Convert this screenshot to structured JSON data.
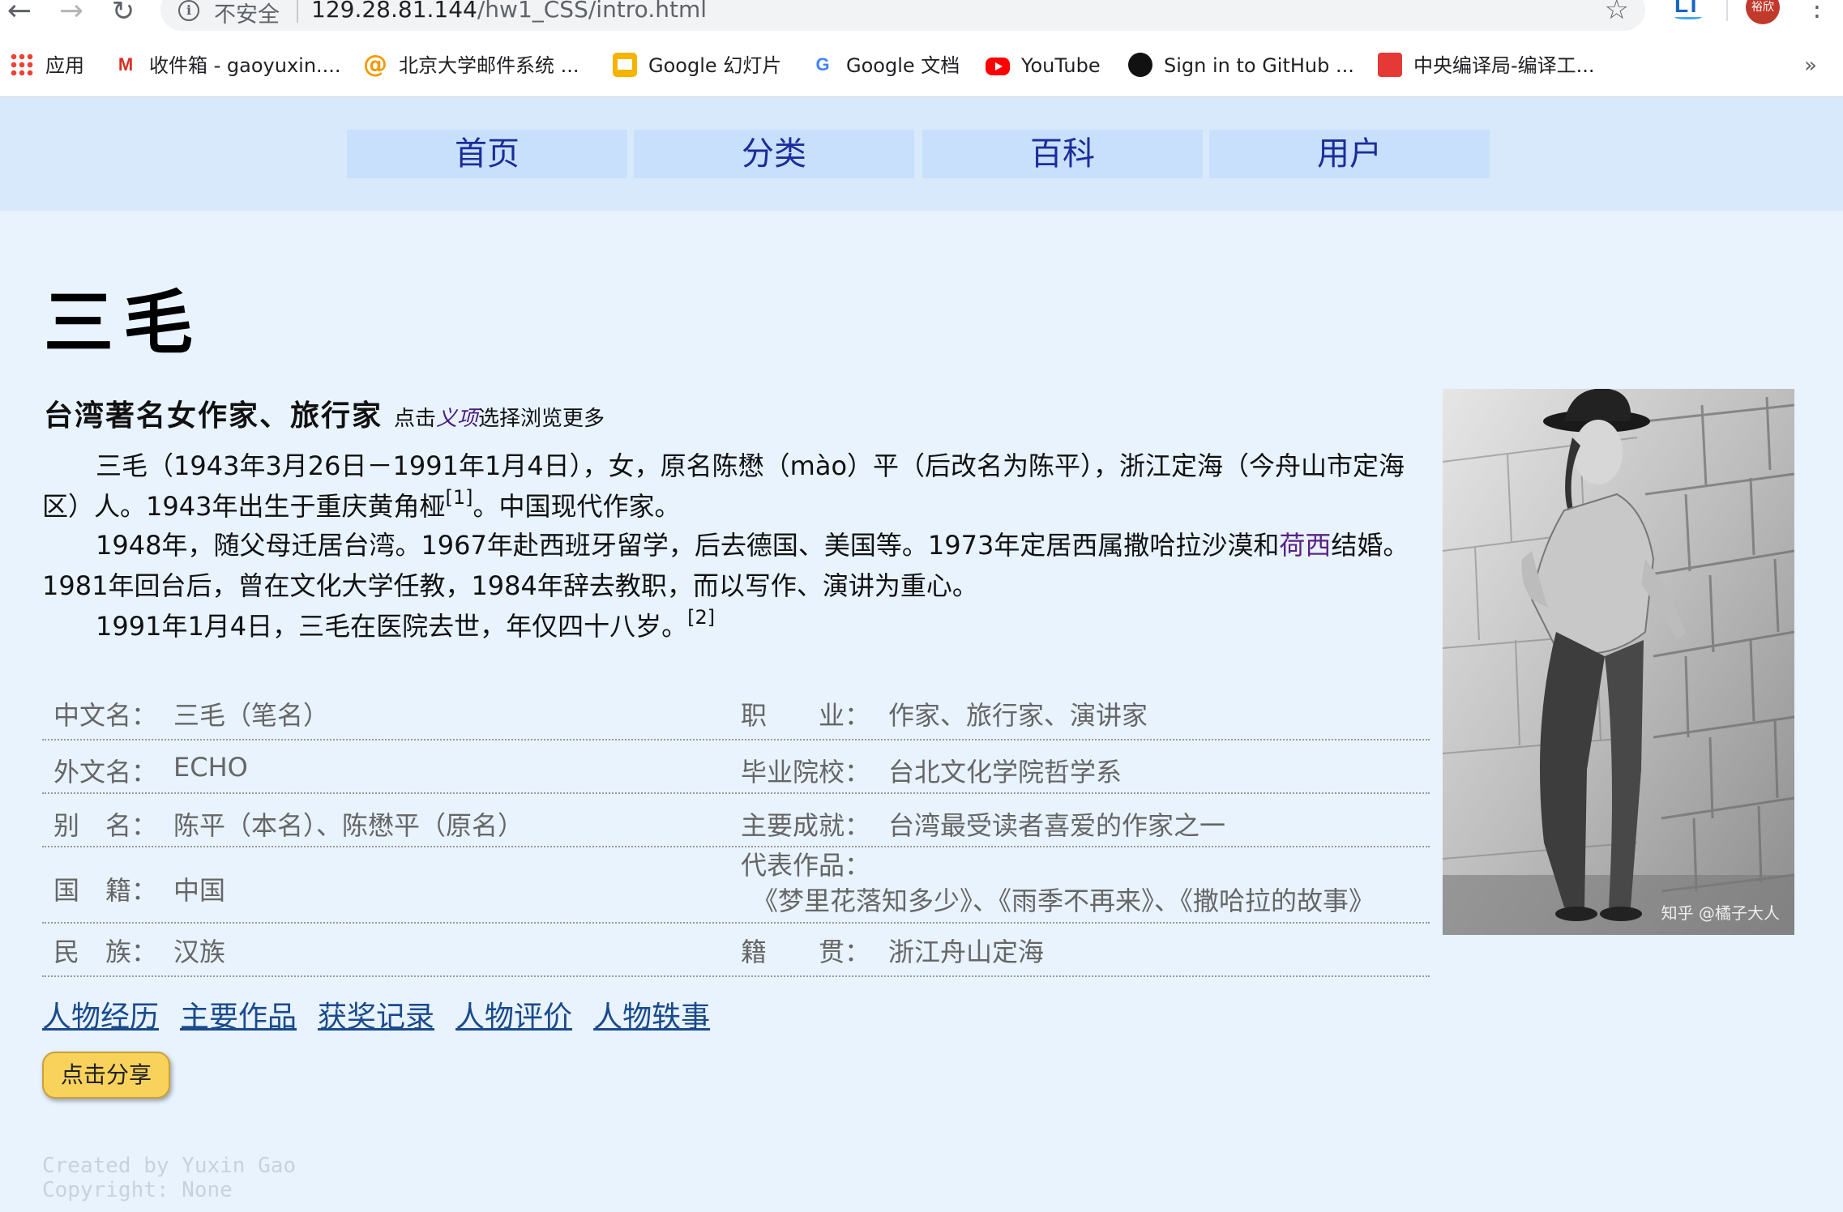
{
  "browser": {
    "security_label": "不安全",
    "url_host": "129.28.81.144",
    "url_path": "/hw1_CSS/intro.html",
    "extension_label": "LT",
    "avatar_text": "裕欣",
    "bookmarks": [
      {
        "label": "应用",
        "icon": "apps-grid-icon"
      },
      {
        "label": "收件箱 - gaoyuxin....",
        "icon": "gmail-icon"
      },
      {
        "label": "北京大学邮件系统 ...",
        "icon": "at-sign-icon"
      },
      {
        "label": "Google 幻灯片",
        "icon": "google-slides-icon"
      },
      {
        "label": "Google 文档",
        "icon": "google-icon"
      },
      {
        "label": "YouTube",
        "icon": "youtube-icon"
      },
      {
        "label": "Sign in to GitHub ...",
        "icon": "github-icon"
      },
      {
        "label": "中央编译局-编译工...",
        "icon": "cctb-icon"
      }
    ],
    "more_label": "»"
  },
  "nav": [
    "首页",
    "分类",
    "百科",
    "用户"
  ],
  "title": "三毛",
  "subtitle": {
    "main": "台湾著名女作家、旅行家",
    "hint_prefix": "点击",
    "hint_link": "义项",
    "hint_suffix": "选择浏览更多"
  },
  "intro": {
    "p1_a": "三毛（1943年3月26日－1991年1月4日），女，原名陈懋（mào）平（后改名为陈平），浙江定海（今舟山市定海区）人。1943年出生于重庆黄角桠",
    "p1_ref": "[1]",
    "p1_b": "。中国现代作家。",
    "p2_a": "1948年，随父母迁居台湾。1967年赴西班牙留学，后去德国、美国等。1973年定居西属撒哈拉沙漠和",
    "p2_link": "荷西",
    "p2_b": "结婚。1981年回台后，曾在文化大学任教，1984年辞去教职，而以写作、演讲为重心。",
    "p3_a": "1991年1月4日，三毛在医院去世，年仅四十八岁。",
    "p3_ref": "[2]"
  },
  "infobox": [
    {
      "k1": "中文名：",
      "v1": "三毛（笔名）",
      "k2": "职　　业：",
      "v2": "作家、旅行家、演讲家"
    },
    {
      "k1": "外文名：",
      "v1": "ECHO",
      "k2": "毕业院校：",
      "v2": "台北文化学院哲学系"
    },
    {
      "k1": "别　名：",
      "v1": "陈平（本名）、陈懋平（原名）",
      "k2": "主要成就：",
      "v2": "台湾最受读者喜爱的作家之一"
    },
    {
      "k1": "国　籍：",
      "v1": "中国",
      "k2": "代表作品：",
      "v2": "《梦里花落知多少》、《雨季不再来》、《撒哈拉的故事》"
    },
    {
      "k1": "民　族：",
      "v1": "汉族",
      "k2": "籍　　贯：",
      "v2": "浙江舟山定海"
    }
  ],
  "photo_credit": "知乎 @橘子大人",
  "section_links": [
    "人物经历",
    "主要作品",
    "获奖记录",
    "人物评价",
    "人物轶事"
  ],
  "share_button": "点击分享",
  "footer": {
    "line1": "Created by Yuxin Gao",
    "line2": "Copyright: None"
  }
}
